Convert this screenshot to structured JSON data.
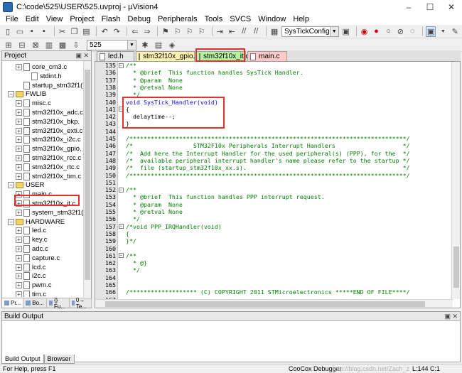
{
  "window": {
    "title": "C:\\code\\525\\USER\\525.uvproj - µVision4",
    "minimize": "–",
    "maximize": "☐",
    "close": "✕"
  },
  "menu": [
    "File",
    "Edit",
    "View",
    "Project",
    "Flash",
    "Debug",
    "Peripherals",
    "Tools",
    "SVCS",
    "Window",
    "Help"
  ],
  "toolbar": {
    "function_combo": "SysTickConfig",
    "target_combo": "525"
  },
  "project_panel": {
    "title": "Project",
    "controls": "▣ ✕",
    "tree": [
      {
        "type": "file",
        "label": "core_cm3.c",
        "indent": 1,
        "expand": "+"
      },
      {
        "type": "file",
        "label": "stdint.h",
        "indent": 2,
        "expand": ""
      },
      {
        "type": "file",
        "label": "startup_stm32f1(",
        "indent": 1,
        "expand": ""
      },
      {
        "type": "folder",
        "label": "FWLIB",
        "indent": 0,
        "expand": "−"
      },
      {
        "type": "file",
        "label": "misc.c",
        "indent": 1,
        "expand": "+"
      },
      {
        "type": "file",
        "label": "stm32f10x_adc.c",
        "indent": 1,
        "expand": "+"
      },
      {
        "type": "file",
        "label": "stm32f10x_bkp.",
        "indent": 1,
        "expand": "+"
      },
      {
        "type": "file",
        "label": "stm32f10x_exti.c",
        "indent": 1,
        "expand": "+"
      },
      {
        "type": "file",
        "label": "stm32f10x_i2c.c",
        "indent": 1,
        "expand": "+"
      },
      {
        "type": "file",
        "label": "stm32f10x_gpio.",
        "indent": 1,
        "expand": "+"
      },
      {
        "type": "file",
        "label": "stm32f10x_rcc.c",
        "indent": 1,
        "expand": "+"
      },
      {
        "type": "file",
        "label": "stm32f10x_rtc.c",
        "indent": 1,
        "expand": "+"
      },
      {
        "type": "file",
        "label": "stm32f10x_tim.c",
        "indent": 1,
        "expand": "+"
      },
      {
        "type": "folder",
        "label": "USER",
        "indent": 0,
        "expand": "−"
      },
      {
        "type": "file",
        "label": "main.c",
        "indent": 1,
        "expand": "+"
      },
      {
        "type": "file",
        "label": "stm32f10x_it.c",
        "indent": 1,
        "expand": "+"
      },
      {
        "type": "file",
        "label": "system_stm32f1(",
        "indent": 1,
        "expand": "+"
      },
      {
        "type": "folder",
        "label": "HARDWARE",
        "indent": 0,
        "expand": "−"
      },
      {
        "type": "file",
        "label": "led.c",
        "indent": 1,
        "expand": "+"
      },
      {
        "type": "file",
        "label": "key.c",
        "indent": 1,
        "expand": "+"
      },
      {
        "type": "file",
        "label": "adc.c",
        "indent": 1,
        "expand": "+"
      },
      {
        "type": "file",
        "label": "capture.c",
        "indent": 1,
        "expand": "+"
      },
      {
        "type": "file",
        "label": "lcd.c",
        "indent": 1,
        "expand": "+"
      },
      {
        "type": "file",
        "label": "i2c.c",
        "indent": 1,
        "expand": "+"
      },
      {
        "type": "file",
        "label": "pwm.c",
        "indent": 1,
        "expand": "+"
      },
      {
        "type": "file",
        "label": "tim.c",
        "indent": 1,
        "expand": "+"
      }
    ],
    "tabs": [
      "Pr...",
      "Bo...",
      "{} Fu...",
      "0→ Te..."
    ]
  },
  "editor": {
    "tabs": [
      {
        "label": "led.h",
        "style": "plain"
      },
      {
        "label": "stm32f10x_gpio.h",
        "style": "inactive1"
      },
      {
        "label": "stm32f10x_it.c",
        "style": "active"
      },
      {
        "label": "main.c",
        "style": "inactive2"
      }
    ],
    "lines": [
      {
        "n": "135",
        "fold": "−",
        "kind": "com",
        "text": "/**"
      },
      {
        "n": "136",
        "fold": "",
        "kind": "com",
        "text": "  * @brief  This function handles SysTick Handler."
      },
      {
        "n": "137",
        "fold": "",
        "kind": "com",
        "text": "  * @param  None"
      },
      {
        "n": "138",
        "fold": "",
        "kind": "com",
        "text": "  * @retval None"
      },
      {
        "n": "139",
        "fold": "",
        "kind": "com",
        "text": "  */"
      },
      {
        "n": "140",
        "fold": "",
        "kind": "kw",
        "text": "void SysTick_Handler(void)"
      },
      {
        "n": "141",
        "fold": "−",
        "kind": "norm",
        "text": "{"
      },
      {
        "n": "142",
        "fold": "",
        "kind": "norm",
        "text": "  delaytime--;"
      },
      {
        "n": "143",
        "fold": "",
        "kind": "norm",
        "text": "}"
      },
      {
        "n": "144",
        "fold": "",
        "kind": "norm",
        "text": ""
      },
      {
        "n": "145",
        "fold": "",
        "kind": "com",
        "text": "/******************************************************************************/"
      },
      {
        "n": "146",
        "fold": "",
        "kind": "com",
        "text": "/*                 STM32F10x Peripherals Interrupt Handlers                   */"
      },
      {
        "n": "147",
        "fold": "",
        "kind": "com",
        "text": "/*  Add here the Interrupt Handler for the used peripheral(s) (PPP), for the  */"
      },
      {
        "n": "148",
        "fold": "",
        "kind": "com",
        "text": "/*  available peripheral interrupt handler's name please refer to the startup */"
      },
      {
        "n": "149",
        "fold": "",
        "kind": "com",
        "text": "/*  file (startup_stm32f10x_xx.s).                                            */"
      },
      {
        "n": "150",
        "fold": "",
        "kind": "com",
        "text": "/******************************************************************************/"
      },
      {
        "n": "151",
        "fold": "",
        "kind": "norm",
        "text": ""
      },
      {
        "n": "152",
        "fold": "−",
        "kind": "com",
        "text": "/**"
      },
      {
        "n": "153",
        "fold": "",
        "kind": "com",
        "text": "  * @brief  This function handles PPP interrupt request."
      },
      {
        "n": "154",
        "fold": "",
        "kind": "com",
        "text": "  * @param  None"
      },
      {
        "n": "155",
        "fold": "",
        "kind": "com",
        "text": "  * @retval None"
      },
      {
        "n": "156",
        "fold": "",
        "kind": "com",
        "text": "  */"
      },
      {
        "n": "157",
        "fold": "−",
        "kind": "com",
        "text": "/*void PPP_IRQHandler(void)"
      },
      {
        "n": "158",
        "fold": "",
        "kind": "com",
        "text": "{"
      },
      {
        "n": "159",
        "fold": "",
        "kind": "com",
        "text": "}*/"
      },
      {
        "n": "160",
        "fold": "",
        "kind": "norm",
        "text": ""
      },
      {
        "n": "161",
        "fold": "−",
        "kind": "com",
        "text": "/**"
      },
      {
        "n": "162",
        "fold": "",
        "kind": "com",
        "text": "  * @}"
      },
      {
        "n": "163",
        "fold": "",
        "kind": "com",
        "text": "  */"
      },
      {
        "n": "164",
        "fold": "",
        "kind": "norm",
        "text": ""
      },
      {
        "n": "165",
        "fold": "",
        "kind": "norm",
        "text": ""
      },
      {
        "n": "166",
        "fold": "",
        "kind": "com",
        "text": "/******************* (C) COPYRIGHT 2011 STMicroelectronics *****END OF FILE****/"
      },
      {
        "n": "167",
        "fold": "",
        "kind": "norm",
        "text": ""
      }
    ]
  },
  "build_output": {
    "title": "Build Output",
    "controls": "▣ ✕",
    "tabs": [
      "Build Output",
      "Browser"
    ]
  },
  "status": {
    "help": "For Help, press F1",
    "debugger": "CooCox Debugger",
    "watermark": "http://blog.csdn.net/Zach_z",
    "position": "L:144 C:1"
  },
  "colors": {
    "highlight_red": "#e53030",
    "comment_green": "#008000",
    "keyword_blue": "#0000ff"
  }
}
